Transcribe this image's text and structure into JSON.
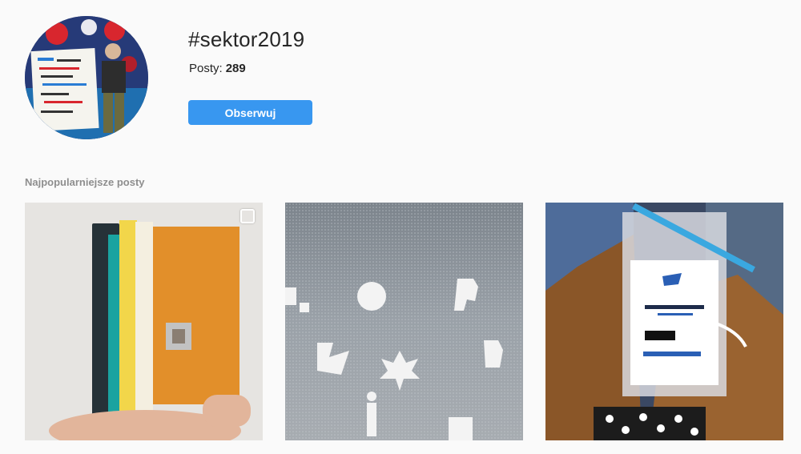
{
  "hashtag": {
    "title": "#sektor2019",
    "posts_label": "Posty:",
    "posts_count": "289",
    "follow_label": "Obserwuj"
  },
  "section": {
    "top_posts_label": "Najpopularniejsze posty"
  },
  "colors": {
    "accent": "#3897f0",
    "background": "#fafafa",
    "muted_text": "#8e8e8e"
  },
  "posts": [
    {
      "kind": "books-photo",
      "multi": true,
      "icon": "carousel-icon"
    },
    {
      "kind": "patterned-glass-photo",
      "multi": false
    },
    {
      "kind": "conference-badge-photo",
      "multi": false
    }
  ]
}
